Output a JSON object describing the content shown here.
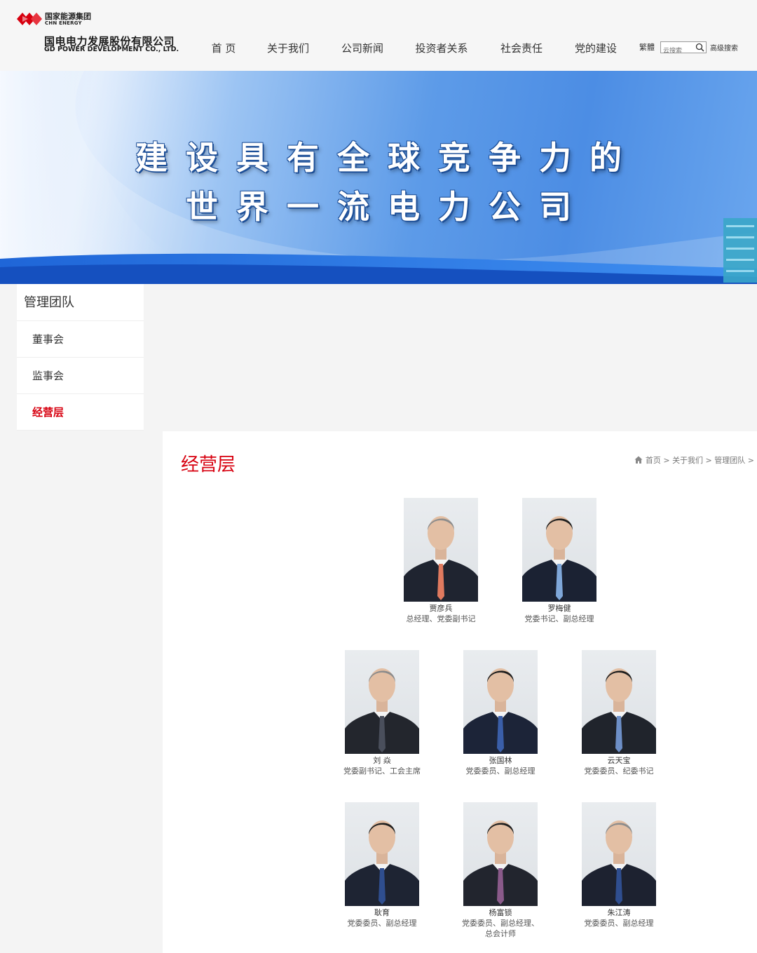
{
  "header": {
    "logo": {
      "line1": "国家能源集团",
      "line2": "CHN ENERGY",
      "line3": "国电电力发展股份有限公司",
      "line4": "GD POWER DEVELOPMENT CO., LTD."
    },
    "nav": [
      {
        "label": "首 页"
      },
      {
        "label": "关于我们"
      },
      {
        "label": "公司新闻"
      },
      {
        "label": "投资者关系"
      },
      {
        "label": "社会责任"
      },
      {
        "label": "党的建设"
      }
    ],
    "traditional": "繁體",
    "search_placeholder": "云搜索",
    "advanced_search": "高级搜索",
    "brand_color": "#d7000f"
  },
  "banner": {
    "line1": "建设具有全球竞争力的",
    "line2": "世界一流电力公司"
  },
  "sidebar": {
    "title": "管理团队",
    "items": [
      {
        "label": "董事会",
        "active": false
      },
      {
        "label": "监事会",
        "active": false
      },
      {
        "label": "经营层",
        "active": true
      }
    ]
  },
  "content": {
    "title": "经营层",
    "breadcrumb": [
      "首页",
      "关于我们",
      "管理团队"
    ],
    "people": [
      {
        "name": "贾彦兵",
        "title1": "总经理、党委副书记",
        "title2": ""
      },
      {
        "name": "罗梅健",
        "title1": "党委书记、副总经理",
        "title2": ""
      },
      {
        "name": "刘 焱",
        "title1": "党委副书记、工会主席",
        "title2": ""
      },
      {
        "name": "张国林",
        "title1": "党委委员、副总经理",
        "title2": ""
      },
      {
        "name": "云天宝",
        "title1": "党委委员、纪委书记",
        "title2": ""
      },
      {
        "name": "耿育",
        "title1": "党委委员、副总经理",
        "title2": ""
      },
      {
        "name": "杨富锁",
        "title1": "党委委员、副总经理、",
        "title2": "总会计师"
      },
      {
        "name": "朱江涛",
        "title1": "党委委员、副总经理",
        "title2": ""
      }
    ]
  }
}
